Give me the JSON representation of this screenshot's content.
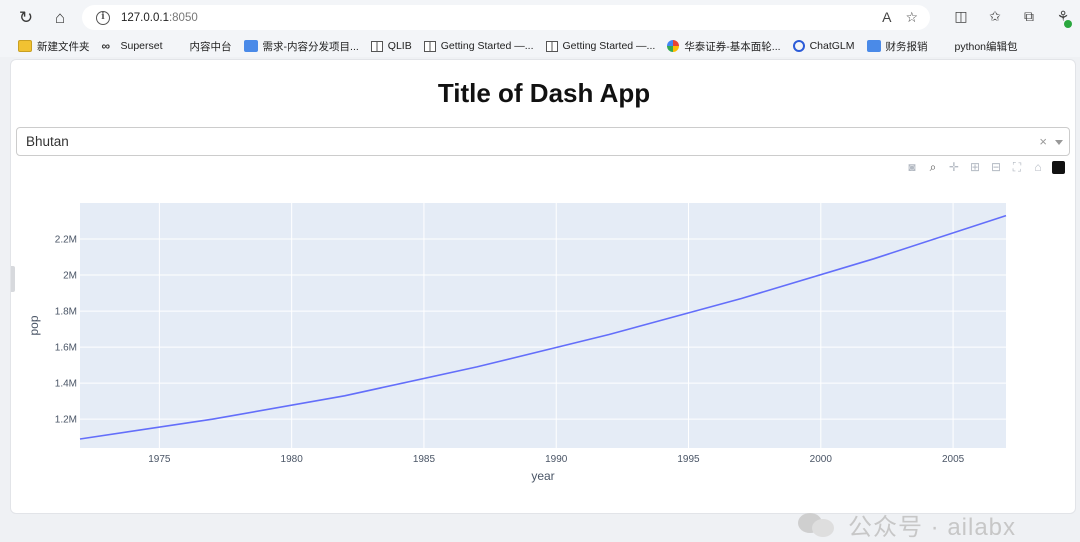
{
  "browser": {
    "url_host": "127.0.0.1",
    "url_port": ":8050",
    "bookmarks": [
      {
        "label": "新建文件夹",
        "icon": "folder-icon"
      },
      {
        "label": "Superset",
        "icon": "loop-icon"
      },
      {
        "label": "内容中台",
        "icon": "page-icon"
      },
      {
        "label": "需求-内容分发项目...",
        "icon": "app-icon"
      },
      {
        "label": "QLIB",
        "icon": "book-icon"
      },
      {
        "label": "Getting Started —...",
        "icon": "book-icon"
      },
      {
        "label": "Getting Started —...",
        "icon": "book-icon"
      },
      {
        "label": "华泰证券-基本面轮...",
        "icon": "color-circle-icon"
      },
      {
        "label": "ChatGLM",
        "icon": "chatglm-icon"
      },
      {
        "label": "财务报销",
        "icon": "app-icon"
      },
      {
        "label": "python编辑包",
        "icon": "page-icon"
      }
    ]
  },
  "app": {
    "title": "Title of Dash App",
    "dropdown": {
      "value": "Bhutan",
      "clear_symbol": "×"
    }
  },
  "chart_data": {
    "type": "line",
    "xlabel": "year",
    "ylabel": "pop",
    "x_ticks": [
      "1975",
      "1980",
      "1985",
      "1990",
      "1995",
      "2000",
      "2005"
    ],
    "y_ticks": [
      "1.2M",
      "1.4M",
      "1.6M",
      "1.8M",
      "2M",
      "2.2M"
    ],
    "xlim": [
      1972,
      2007
    ],
    "ylim": [
      1.04,
      2.4
    ],
    "y_unit": "M",
    "series": [
      {
        "x": [
          1972,
          1977,
          1982,
          1987,
          1992,
          1997,
          2002,
          2007
        ],
        "y": [
          1.09,
          1.2,
          1.33,
          1.49,
          1.67,
          1.87,
          2.09,
          2.33
        ],
        "color": "#636efa"
      }
    ],
    "background": "#e5ecf6",
    "grid": true
  },
  "watermark": {
    "text": "公众号 · ailabx"
  }
}
